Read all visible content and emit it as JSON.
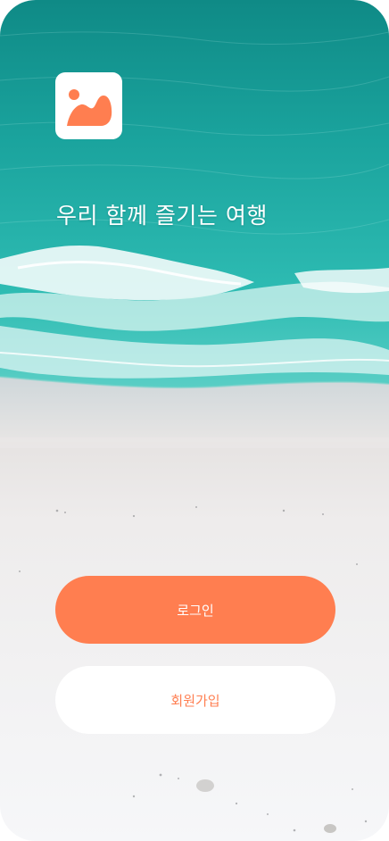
{
  "app": {
    "logo_icon": "landscape-image-icon",
    "tagline": "우리 함께 즐기는 여행"
  },
  "actions": {
    "login_label": "로그인",
    "signup_label": "회원가입"
  },
  "colors": {
    "accent": "#ff7e50",
    "button_text_light": "#ffffff",
    "sea": "#1fa6a0",
    "sand": "#f4f4f6"
  }
}
